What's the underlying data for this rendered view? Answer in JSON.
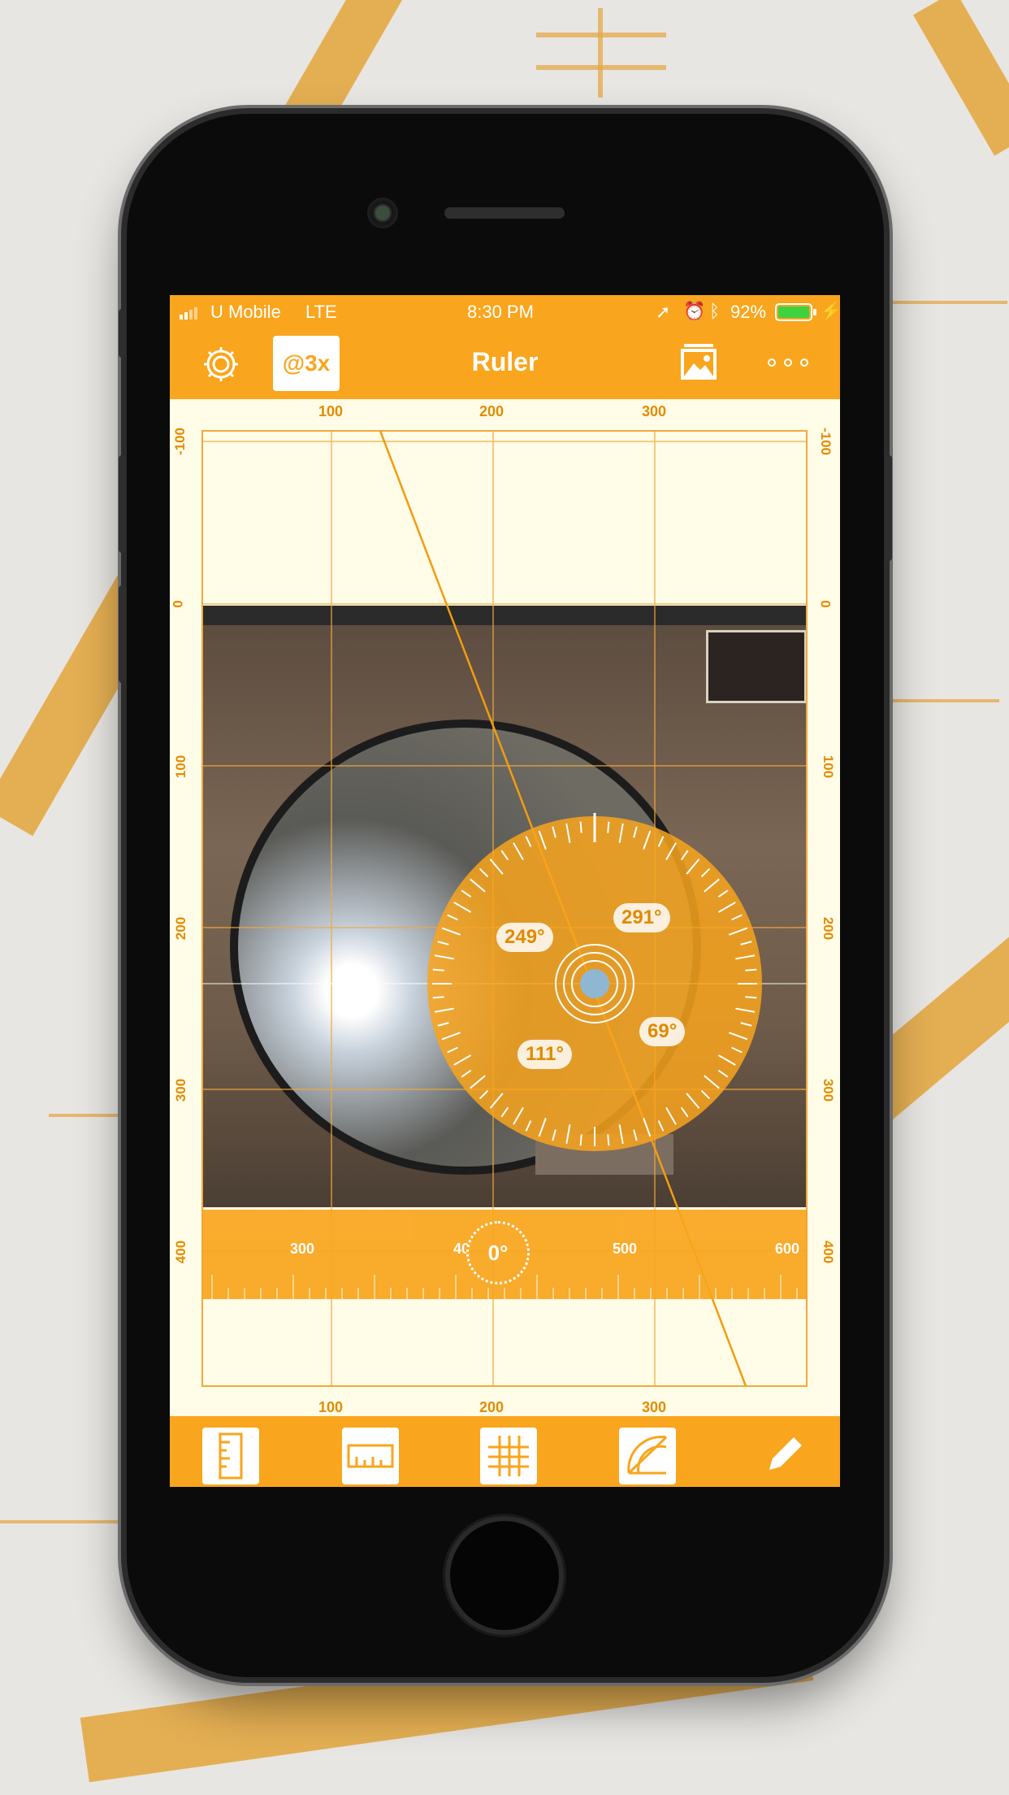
{
  "status": {
    "carrier": "U Mobile",
    "network": "LTE",
    "time": "8:30 PM",
    "battery": "92%"
  },
  "nav": {
    "title": "Ruler",
    "scale_badge": "@3x"
  },
  "rulers": {
    "top": [
      "100",
      "200",
      "300"
    ],
    "bottom": [
      "100",
      "200",
      "300"
    ],
    "left": [
      "-100",
      "0",
      "100",
      "200",
      "300",
      "400"
    ],
    "right": [
      "-100",
      "0",
      "100",
      "200",
      "300",
      "400"
    ]
  },
  "protractor": {
    "angles": {
      "a249": "249°",
      "a291": "291°",
      "a111": "111°",
      "a69": "69°"
    }
  },
  "horizontal_ruler": {
    "labels": [
      "300",
      "40",
      "500",
      "600"
    ],
    "level": "0°"
  },
  "toolbar": {
    "icons": [
      "ruler-vertical-icon",
      "ruler-horizontal-icon",
      "grid-icon",
      "protractor-icon",
      "pencil-icon"
    ]
  },
  "colors": {
    "accent": "#f9a51d",
    "screen_bg": "#fffce8",
    "ruler_text": "#e28c00"
  }
}
